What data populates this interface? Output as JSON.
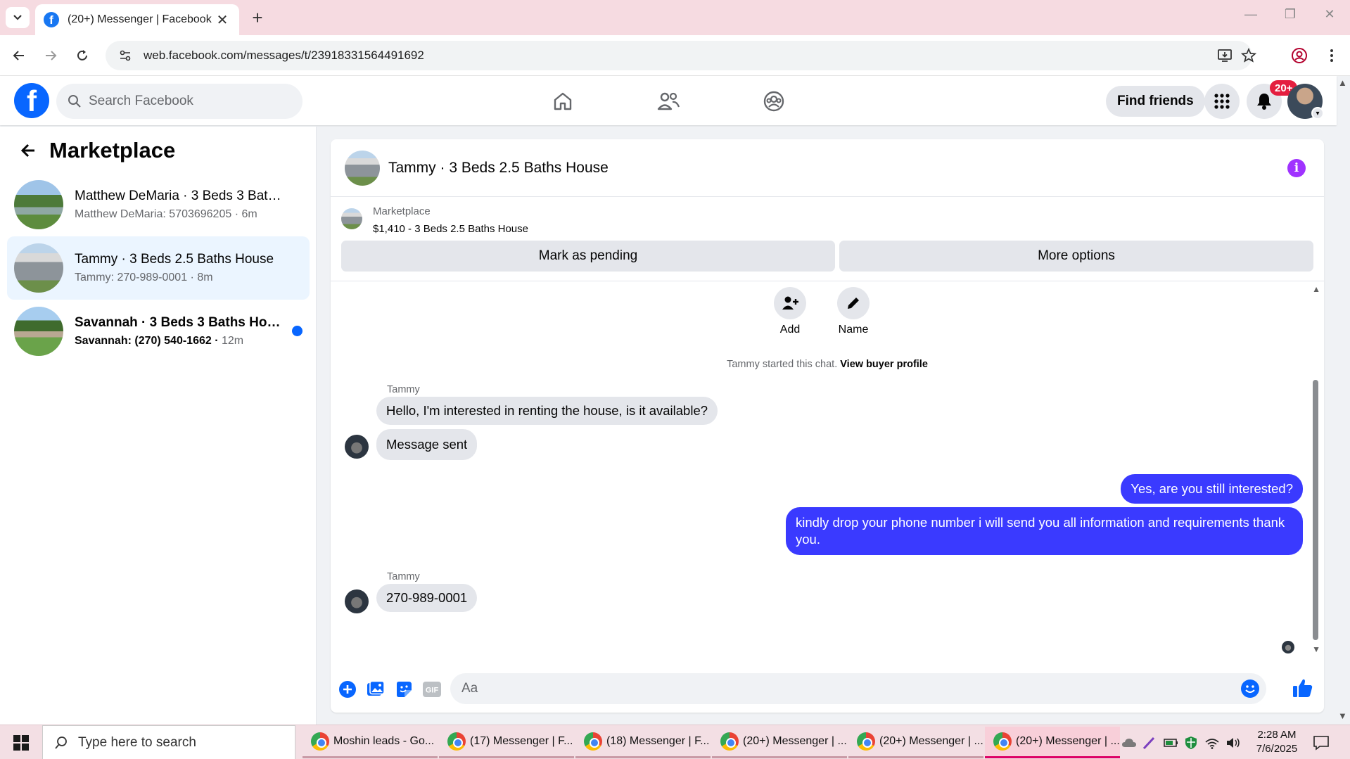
{
  "browser": {
    "tab_title": "(20+) Messenger | Facebook",
    "url": "web.facebook.com/messages/t/23918331564491692"
  },
  "fb": {
    "search_placeholder": "Search Facebook",
    "find_friends_label": "Find friends",
    "notification_count": "20+",
    "brand_color": "#0866ff"
  },
  "sidebar": {
    "title": "Marketplace",
    "conversations": [
      {
        "name": "Matthew DeMaria · 3 Beds 3 Baths...",
        "preview": "Matthew DeMaria: 5703696205",
        "time": "6m",
        "unread": false,
        "active": false
      },
      {
        "name": "Tammy · 3 Beds 2.5 Baths House",
        "preview": "Tammy: 270-989-0001",
        "time": "8m",
        "unread": false,
        "active": true
      },
      {
        "name": "Savannah · 3 Beds 3 Baths House",
        "preview": "Savannah: (270) 540-1662",
        "time": "12m",
        "unread": true,
        "active": false
      }
    ]
  },
  "chat": {
    "title": "Tammy · 3 Beds 2.5 Baths House",
    "marketplace_label": "Marketplace",
    "listing": "$1,410 - 3 Beds 2.5 Baths House",
    "mark_pending_label": "Mark as pending",
    "more_options_label": "More options",
    "add_label": "Add",
    "name_label": "Name",
    "system_text": "Tammy started this chat.",
    "buyer_profile_link": "View buyer profile",
    "messages": [
      {
        "sender": "Tammy",
        "text": "Hello, I'm interested in renting the house, is it available?",
        "direction": "in"
      },
      {
        "text": "Message sent",
        "direction": "in"
      },
      {
        "text": "Yes, are you still interested?",
        "direction": "out"
      },
      {
        "text": "kindly drop your phone number i will send you all information and requirements thank you.",
        "direction": "out"
      },
      {
        "sender": "Tammy",
        "text": "270-989-0001",
        "direction": "in"
      }
    ],
    "composer_placeholder": "Aa",
    "outgoing_color": "#3a3aff"
  },
  "taskbar": {
    "search_placeholder": "Type here to search",
    "apps": [
      "Moshin leads - Go...",
      "(17) Messenger | F...",
      "(18) Messenger | F...",
      "(20+) Messenger | ...",
      "(20+) Messenger | ...",
      "(20+) Messenger | ..."
    ],
    "time": "2:28 AM",
    "date": "7/6/2025"
  }
}
